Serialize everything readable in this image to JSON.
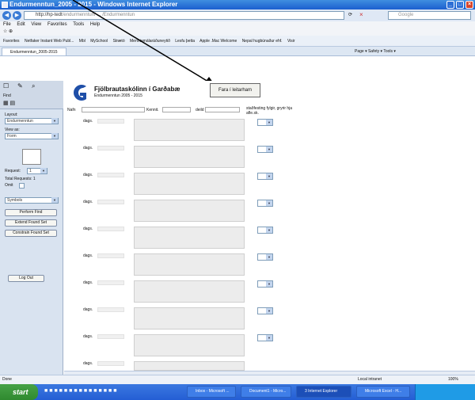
{
  "window": {
    "title": "Endurmenntun_2005 - 2015 - Windows Internet Explorer"
  },
  "address": {
    "url_prefix": "http://hp-tedt",
    "url_rest": "/endurmenntun/ ... /Endurmenntun",
    "search_placeholder": "Google"
  },
  "menu": [
    "File",
    "Edit",
    "View",
    "Favorites",
    "Tools",
    "Help"
  ],
  "favorites": [
    "Favorites",
    "Netfaker Instant Web Publ...",
    "Mbl",
    "MySchool",
    "Strætó",
    "Menntamálaráðuneytið",
    "Lesfu þetta",
    "Apple .Mac Welcome",
    "Nepal hugbúnaður ehf.",
    "Visir"
  ],
  "tab": {
    "label": "Endurmenntun_2005-2015"
  },
  "tab_tools": "Page ▾  Safety ▾  Tools ▾",
  "sidebar": {
    "layout_label": "Layout:",
    "layout_value": "Endurmenntun",
    "view_label": "View as:",
    "view_value": "Form",
    "request_label": "Request:",
    "request_value": "1",
    "total_requests": "Total Requests: 1",
    "omit_label": "Omit",
    "symbols_value": "Symbols",
    "buttons": [
      "Perform Find",
      "Extend Found Set",
      "Constrain Found Set"
    ],
    "logout": "Log Out"
  },
  "form": {
    "school_name": "Fjölbrautaskólinn í Garðabæ",
    "school_sub": "Endurmenntun 2005 - 2015",
    "go_button": "Fara í leitarham",
    "name_label": "Nafn",
    "kennit_label": "Kennit.",
    "deild_label": "deild",
    "skil_label": "staðfesting fylgir, gryrir hja afle.sk.",
    "row_label": "dags."
  },
  "status": {
    "left": "Done",
    "zone": "Local intranet",
    "zoom": "100%"
  },
  "taskbar": {
    "start": "start",
    "items": [
      "Inbox - Microsoft ...",
      "Document1 - Micro...",
      "3 Internet Explorer",
      "Microsoft Excel - H..."
    ]
  }
}
